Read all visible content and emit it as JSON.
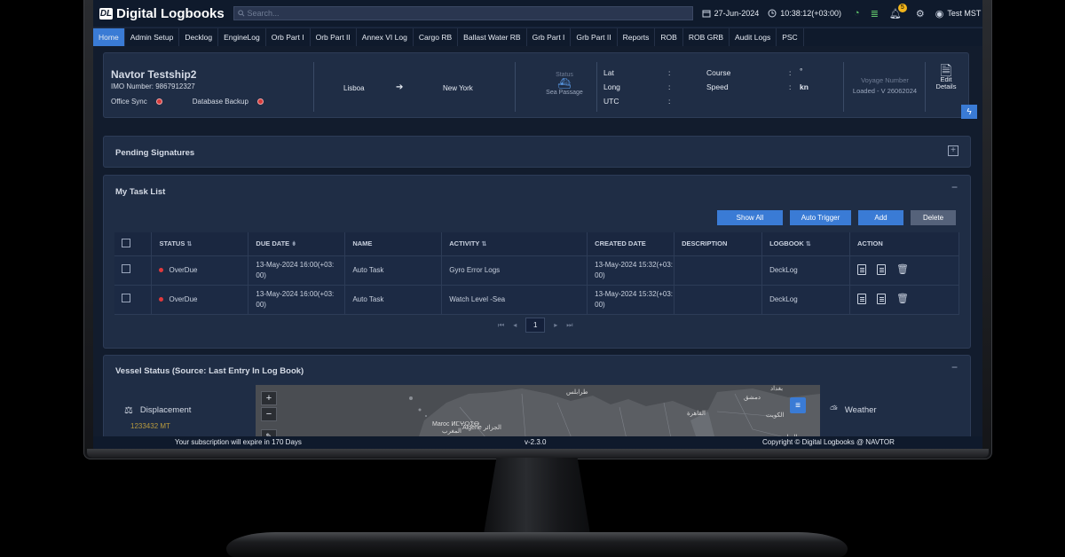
{
  "app": {
    "logo_badge": "DL",
    "title": "Digital Logbooks"
  },
  "search": {
    "placeholder": "Search..."
  },
  "topbar": {
    "date": "27-Jun-2024",
    "time": "10:38:12(+03:00)",
    "notification_count": "5",
    "user": "Test MST"
  },
  "nav": [
    {
      "label": "Home",
      "active": true
    },
    {
      "label": "Admin Setup"
    },
    {
      "label": "Decklog"
    },
    {
      "label": "EngineLog"
    },
    {
      "label": "Orb Part I"
    },
    {
      "label": "Orb Part II"
    },
    {
      "label": "Annex VI Log"
    },
    {
      "label": "Cargo RB"
    },
    {
      "label": "Ballast Water RB"
    },
    {
      "label": "Grb Part I"
    },
    {
      "label": "Grb Part II"
    },
    {
      "label": "Reports"
    },
    {
      "label": "ROB"
    },
    {
      "label": "ROB GRB"
    },
    {
      "label": "Audit Logs"
    },
    {
      "label": "PSC"
    }
  ],
  "vessel": {
    "name": "Navtor Testship2",
    "imo": "IMO Number: 9867912327",
    "office_sync": "Office Sync",
    "database_backup": "Database Backup",
    "from": "Lisboa",
    "to": "New York",
    "status_label": "Status",
    "status_value": "Sea Passage",
    "lat_label": "Lat",
    "long_label": "Long",
    "utc_label": "UTC",
    "course_label": "Course",
    "speed_label": "Speed",
    "colon": ":",
    "course_value": "°",
    "speed_unit": "kn",
    "voyage_label": "Voyage Number",
    "voyage_value": "Loaded - V 26062024",
    "edit_line1": "Edit",
    "edit_line2": "Details"
  },
  "pending": {
    "title": "Pending Signatures"
  },
  "tasks": {
    "title": "My Task List",
    "buttons": {
      "show_all": "Show All",
      "auto_trigger": "Auto Trigger",
      "add": "Add",
      "delete": "Delete"
    },
    "columns": [
      "STATUS",
      "DUE DATE",
      "NAME",
      "ACTIVITY",
      "CREATED DATE",
      "DESCRIPTION",
      "LOGBOOK",
      "ACTION"
    ],
    "rows": [
      {
        "status": "OverDue",
        "due_date_1": "13-May-2024 16:00(+03:",
        "due_date_2": "00)",
        "name": "Auto Task",
        "activity": "Gyro Error Logs",
        "created_1": "13-May-2024 15:32(+03:",
        "created_2": "00)",
        "description": "",
        "logbook": "DeckLog"
      },
      {
        "status": "OverDue",
        "due_date_1": "13-May-2024 16:00(+03:",
        "due_date_2": "00)",
        "name": "Auto Task",
        "activity": "Watch Level -Sea",
        "created_1": "13-May-2024 15:32(+03:",
        "created_2": "00)",
        "description": "",
        "logbook": "DeckLog"
      }
    ],
    "page": "1"
  },
  "vessel_status": {
    "title": "Vessel Status (Source: Last Entry In Log Book)",
    "displacement_label": "Displacement",
    "displacement_value": "1233432 MT",
    "weather_label": "Weather",
    "map_labels": [
      "Algerie الجزائر",
      "Maroc ⵍⵎⵖⵔⵉⴱ",
      "المغرب",
      "طرابلس",
      "القاهرة",
      "دمشق",
      "بغداد",
      "الكويت",
      "الرياض"
    ]
  },
  "footer": {
    "subscription": "Your subscription will expire in 170 Days",
    "version": "v-2.3.0",
    "copyright": "Copyright © Digital Logbooks @ NAVTOR"
  }
}
